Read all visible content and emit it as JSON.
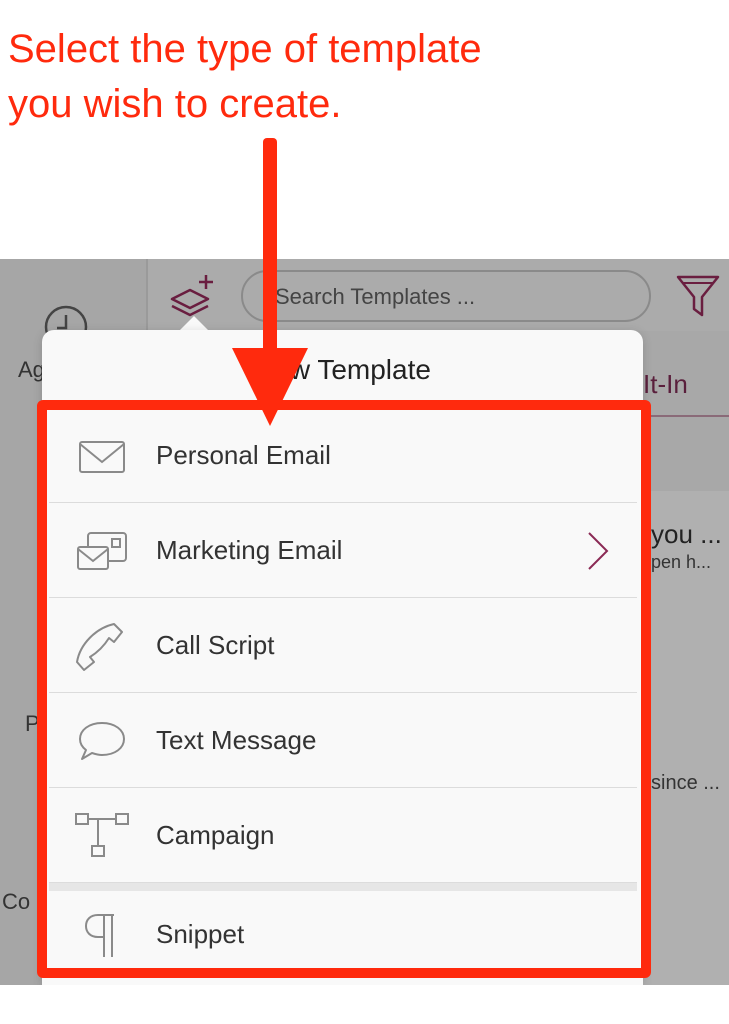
{
  "instruction": {
    "line1": "Select the type of template",
    "line2": "you wish to create."
  },
  "background": {
    "left_fragment_1": "Ag",
    "left_fragment_2": "P",
    "left_fragment_3": "Co",
    "search_placeholder": "Search Templates ...",
    "tab_fragment": "It-In",
    "list_fragment_title": "you ...",
    "list_fragment_sub": "pen h...",
    "list_fragment_2": "since ..."
  },
  "popover": {
    "title": "New Template",
    "items": [
      {
        "label": "Personal Email",
        "icon": "envelope-icon"
      },
      {
        "label": "Marketing Email",
        "icon": "marketing-email-icon",
        "has_submenu": true
      },
      {
        "label": "Call Script",
        "icon": "phone-icon"
      },
      {
        "label": "Text Message",
        "icon": "speech-bubble-icon"
      },
      {
        "label": "Campaign",
        "icon": "campaign-flow-icon"
      },
      {
        "label": "Snippet",
        "icon": "pilcrow-icon"
      }
    ]
  },
  "colors": {
    "annotation_red": "#ff2a0d",
    "accent_maroon": "#8b2a55",
    "icon_gray": "#8a8a8a"
  }
}
